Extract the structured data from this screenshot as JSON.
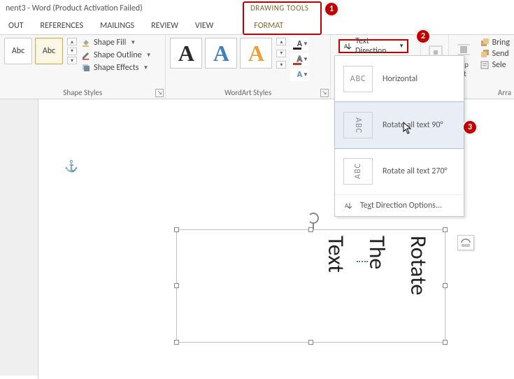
{
  "title": "nent3 - Word (Product Activation Failed)",
  "drawing_tools": "DRAWING TOOLS",
  "tabs": {
    "layout": "OUT",
    "references": "REFERENCES",
    "mailings": "MAILINGS",
    "review": "REVIEW",
    "view": "VIEW",
    "format": "FORMAT"
  },
  "shape_styles": {
    "label": "Shape Styles",
    "swatch": "Abc",
    "fill": "Shape Fill",
    "outline": "Shape Outline",
    "effects": "Shape Effects"
  },
  "wordart": {
    "label": "WordArt Styles",
    "swatch": "A"
  },
  "text_direction": {
    "button": "Text Direction",
    "horizontal": "Horizontal",
    "rotate90": "Rotate all text 90°",
    "rotate270": "Rotate all text 270°",
    "options_pre": "Te",
    "options_x": "x",
    "options_post": "t Direction Options...",
    "thumb": "ABC"
  },
  "arrange": {
    "bring": "Bring",
    "send": "Send",
    "sele": "Sele",
    "label": "Arra",
    "wrap1": "rap",
    "wrap2": "xt"
  },
  "textbox": {
    "l1": "Rotate",
    "l2": "The",
    "l3": "Text"
  },
  "badges": {
    "b1": "1",
    "b2": "2",
    "b3": "3"
  }
}
